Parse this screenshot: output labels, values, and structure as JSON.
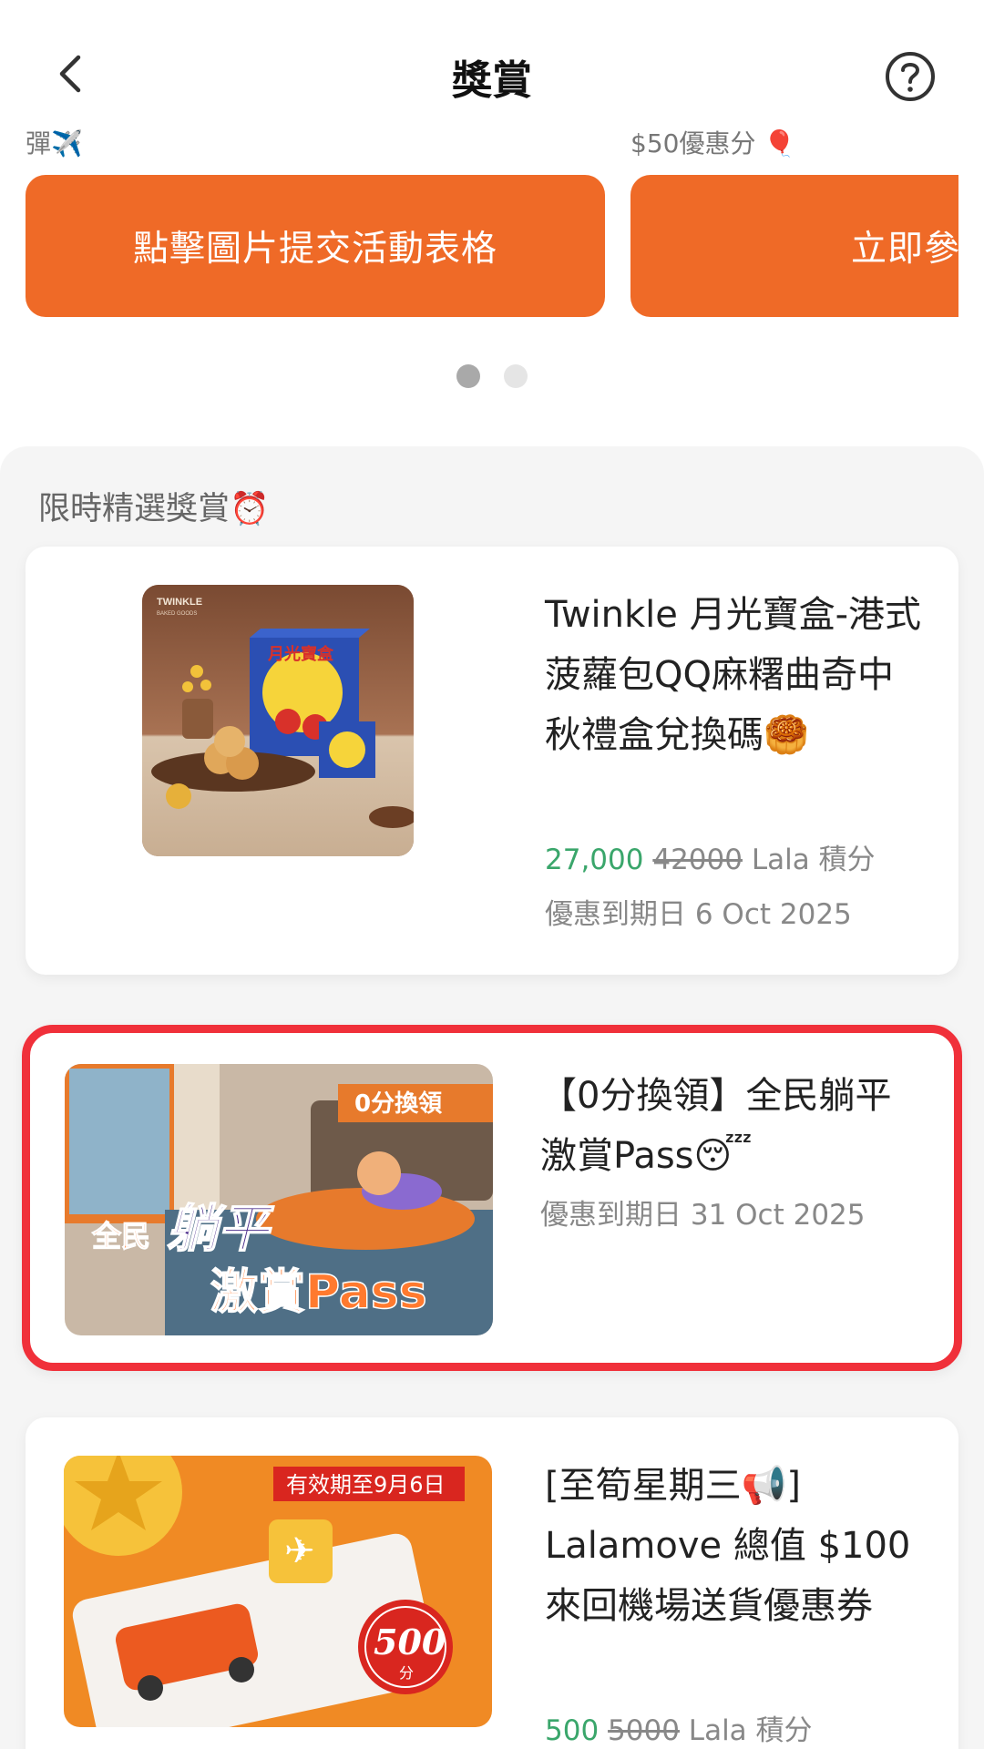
{
  "header": {
    "title": "獎賞"
  },
  "carousel": {
    "peek_left": "彈✈️",
    "peek_right": "$50優惠分 🎈",
    "slides": [
      {
        "label": "點擊圖片提交活動表格"
      },
      {
        "label": "立即參與"
      }
    ],
    "active_index": 0
  },
  "section": {
    "title": "限時精選獎賞⏰"
  },
  "rewards": [
    {
      "image_brand": "TWINKLE",
      "image_sub": "BAKED GOODS",
      "image_box_text": "月光寶盒",
      "title": "Twinkle 月光寶盒-港式菠蘿包QQ麻糬曲奇中秋禮盒兌換碼🥮",
      "points": "27,000",
      "points_original": "42000",
      "points_unit": "Lala 積分",
      "expiry": "優惠到期日 6 Oct 2025"
    },
    {
      "image_badge": "0分換領",
      "image_line1": "全民",
      "image_line2": "躺平",
      "image_line3": "激賞Pass",
      "title": "【0分換領】全民躺平激賞Pass😴",
      "expiry": "優惠到期日 31 Oct 2025"
    },
    {
      "image_ribbon": "有效期至9月6日",
      "image_badge_num": "500",
      "image_badge_unit": "分",
      "title": "[至筍星期三📢] Lalamove 總值 $100 來回機場送貨優惠券",
      "points": "500",
      "points_original": "5000",
      "points_unit": "Lala 積分"
    }
  ],
  "colors": {
    "accent": "#ef6a27",
    "highlight": "#f0303a",
    "points_green": "#3aa66b"
  }
}
